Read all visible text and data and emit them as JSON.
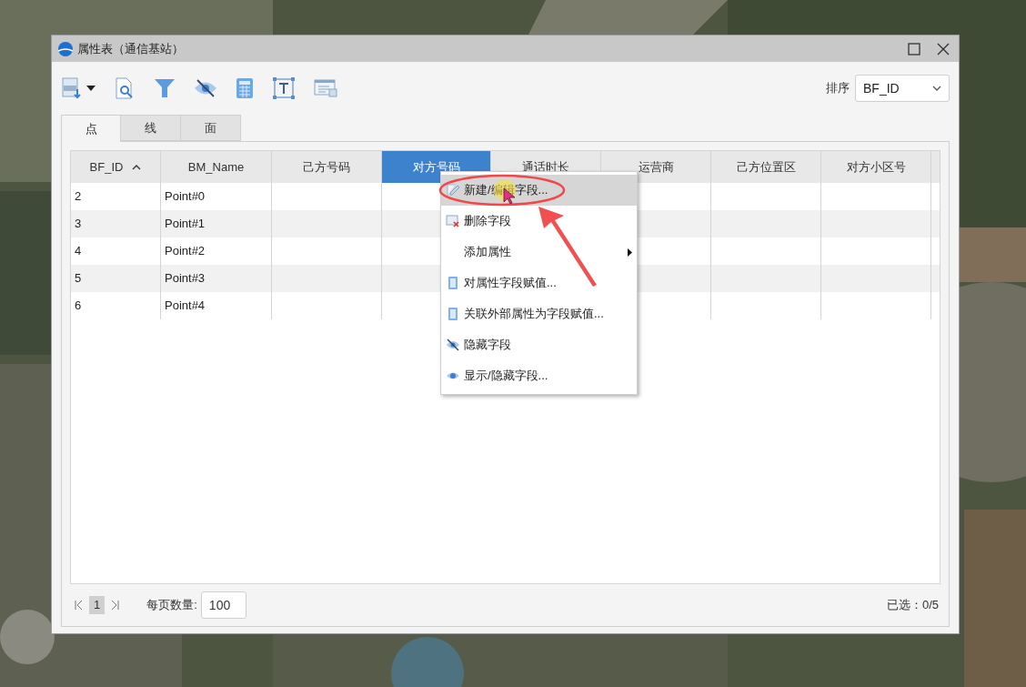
{
  "window": {
    "title": "属性表（通信基站）"
  },
  "sort": {
    "label": "排序",
    "value": "BF_ID"
  },
  "tabs": [
    {
      "label": "点",
      "selected": true
    },
    {
      "label": "线",
      "selected": false
    },
    {
      "label": "面",
      "selected": false
    }
  ],
  "table": {
    "columns": [
      {
        "label": "BF_ID",
        "sorted": true,
        "selected": false
      },
      {
        "label": "BM_Name",
        "sorted": false,
        "selected": false
      },
      {
        "label": "己方号码",
        "sorted": false,
        "selected": false
      },
      {
        "label": "对方号码",
        "sorted": false,
        "selected": true
      },
      {
        "label": "通话时长",
        "sorted": false,
        "selected": false
      },
      {
        "label": "运营商",
        "sorted": false,
        "selected": false
      },
      {
        "label": "己方位置区",
        "sorted": false,
        "selected": false
      },
      {
        "label": "对方小区号",
        "sorted": false,
        "selected": false
      }
    ],
    "rows": [
      [
        "2",
        "Point#0"
      ],
      [
        "3",
        "Point#1"
      ],
      [
        "4",
        "Point#2"
      ],
      [
        "5",
        "Point#3"
      ],
      [
        "6",
        "Point#4"
      ]
    ]
  },
  "context_menu": [
    {
      "label": "新建/编辑字段...",
      "kind": "edit",
      "highlighted": true
    },
    {
      "label": "删除字段",
      "kind": "delete",
      "highlighted": false
    },
    {
      "label": "添加属性",
      "kind": "submenu",
      "highlighted": false
    },
    {
      "label": "对属性字段赋值...",
      "kind": "calc",
      "highlighted": false
    },
    {
      "label": "关联外部属性为字段赋值...",
      "kind": "calc",
      "highlighted": false
    },
    {
      "label": "隐藏字段",
      "kind": "hide",
      "highlighted": false
    },
    {
      "label": "显示/隐藏字段...",
      "kind": "show",
      "highlighted": false
    }
  ],
  "footer": {
    "page": "1",
    "page_size_label": "每页数量:",
    "page_size": "100",
    "selected_count": "已选：0/5"
  }
}
